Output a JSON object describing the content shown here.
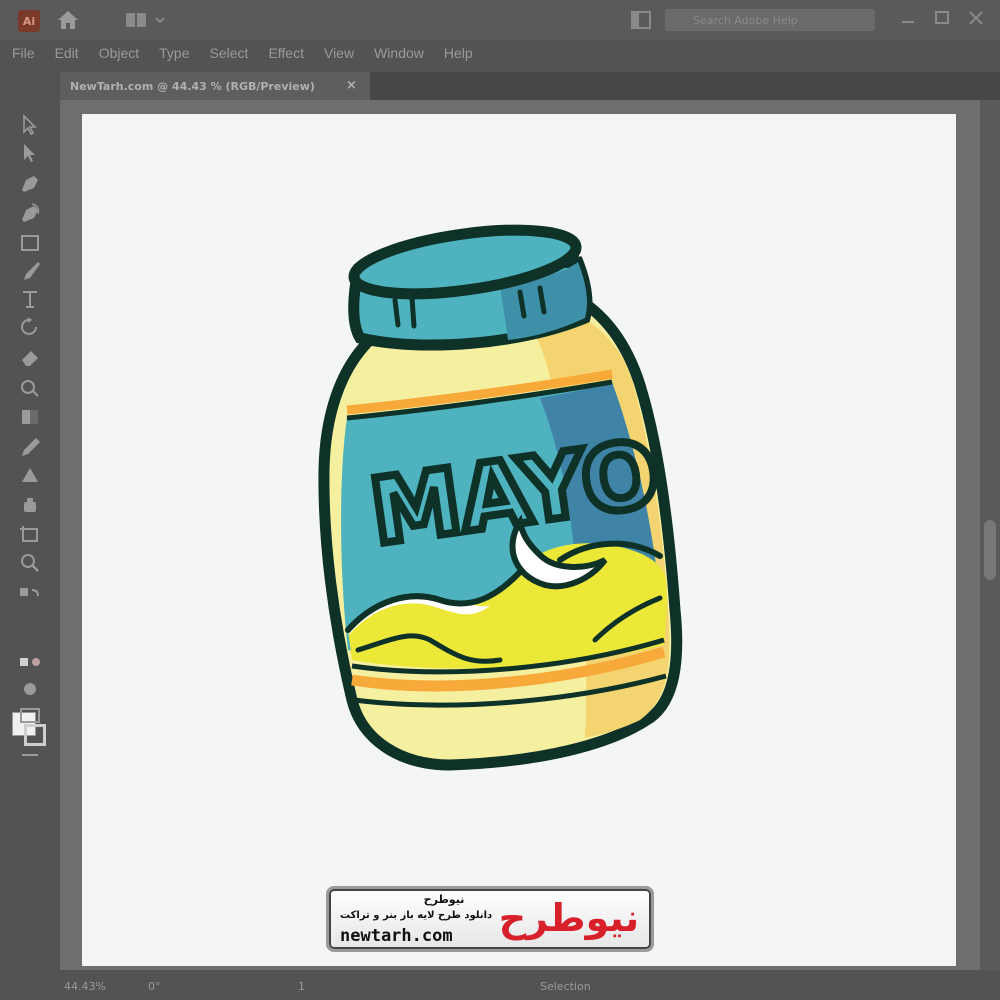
{
  "app": {
    "logo_text": "Ai",
    "search_placeholder": "Search Adobe Help"
  },
  "menu": [
    "File",
    "Edit",
    "Object",
    "Type",
    "Select",
    "Effect",
    "View",
    "Window",
    "Help"
  ],
  "document_tab": {
    "title": "NewTarh.com @ 44.43 % (RGB/Preview)",
    "close_glyph": "×"
  },
  "status": {
    "zoom": "44.43%",
    "rotation": "0°",
    "artboard": "1",
    "mode": "Selection"
  },
  "artwork": {
    "label": "MAYO",
    "colors": {
      "outline": "#0e3128",
      "lid": "#4fb3bf",
      "lid_shade": "#3e8fa8",
      "jar": "#f5f0a0",
      "jar_shade": "#f4d470",
      "label": "#4fb3bf",
      "label_shade": "#3f84a6",
      "mayo": "#ece838",
      "stripe": "#f7a93a"
    }
  },
  "watermark": {
    "title": "نیوطرح",
    "subtitle": "دانلود طرح لایه باز بنر و تراکت",
    "url": "newtarh.com",
    "logo_text": "نیوطرح"
  }
}
